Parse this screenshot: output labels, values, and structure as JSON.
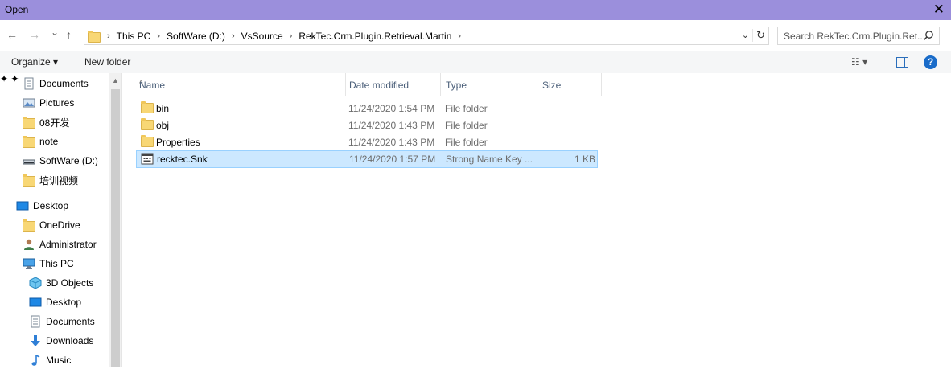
{
  "window": {
    "title": "Open",
    "close_glyph": "✕"
  },
  "nav": {
    "back_glyph": "←",
    "forward_glyph": "→",
    "recent_glyph": "⌄",
    "up_glyph": "↑",
    "breadcrumbs": [
      "This PC",
      "SoftWare (D:)",
      "VsSource",
      "RekTec.Crm.Plugin.Retrieval.Martin"
    ],
    "separator": "›",
    "dropdown_glyph": "⌄",
    "refresh_glyph": "↻"
  },
  "search": {
    "placeholder": "Search RekTec.Crm.Plugin.Ret..."
  },
  "toolbar": {
    "organize_label": "Organize ▾",
    "new_folder_label": "New folder",
    "views_glyph": "☷ ▾",
    "help_glyph": "?"
  },
  "sidebar": {
    "items": [
      {
        "label": "Documents",
        "icon": "documents-icon",
        "pinned": true
      },
      {
        "label": "Pictures",
        "icon": "pictures-icon",
        "pinned": true
      },
      {
        "label": "08开发",
        "icon": "folder-icon"
      },
      {
        "label": "note",
        "icon": "folder-icon"
      },
      {
        "label": "SoftWare (D:)",
        "icon": "drive-icon"
      },
      {
        "label": "培训视频",
        "icon": "folder-icon"
      },
      {
        "label": "Desktop",
        "icon": "desktop-icon"
      },
      {
        "label": "OneDrive",
        "icon": "folder-icon"
      },
      {
        "label": "Administrator",
        "icon": "user-icon"
      },
      {
        "label": "This PC",
        "icon": "pc-icon"
      },
      {
        "label": "3D Objects",
        "icon": "3d-objects-icon"
      },
      {
        "label": "Desktop",
        "icon": "desktop-icon"
      },
      {
        "label": "Documents",
        "icon": "documents-icon"
      },
      {
        "label": "Downloads",
        "icon": "downloads-icon"
      },
      {
        "label": "Music",
        "icon": "music-icon"
      }
    ],
    "pin_glyph": "📌"
  },
  "columns": {
    "name": "Name",
    "date": "Date modified",
    "type": "Type",
    "size": "Size",
    "sort_glyph": "^"
  },
  "files": [
    {
      "name": "bin",
      "date": "11/24/2020 1:54 PM",
      "type": "File folder",
      "size": "",
      "icon": "folder-icon"
    },
    {
      "name": "obj",
      "date": "11/24/2020 1:43 PM",
      "type": "File folder",
      "size": "",
      "icon": "folder-icon"
    },
    {
      "name": "Properties",
      "date": "11/24/2020 1:43 PM",
      "type": "File folder",
      "size": "",
      "icon": "folder-icon"
    },
    {
      "name": "recktec.Snk",
      "date": "11/24/2020 1:57 PM",
      "type": "Strong Name Key ...",
      "size": "1 KB",
      "icon": "snk-file-icon",
      "selected": true
    }
  ],
  "colors": {
    "titlebar": "#9b8fdc",
    "selection": "#cce8ff",
    "selection_border": "#99d1ff"
  }
}
